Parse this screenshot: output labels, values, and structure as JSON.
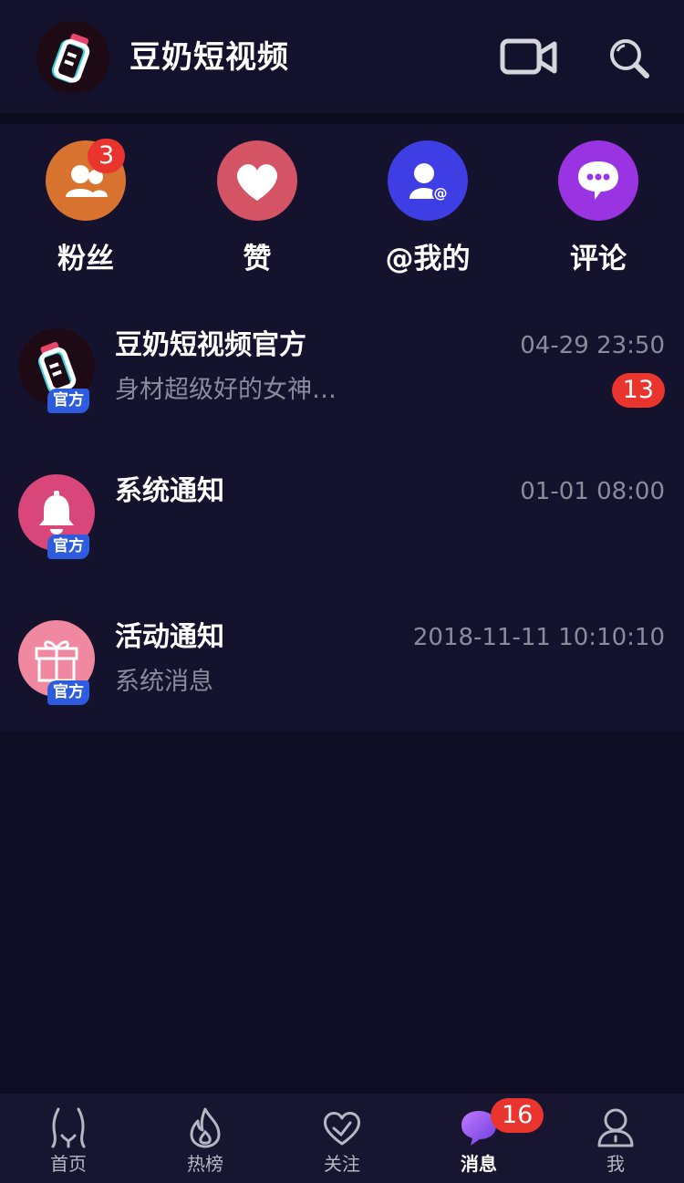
{
  "header": {
    "app_name": "豆奶短视频",
    "logo_icon": "milk-bottle-icon",
    "video_icon": "video-camera-icon",
    "search_icon": "search-icon"
  },
  "actions": [
    {
      "label": "粉丝",
      "icon": "fans-icon",
      "color": "#d8742f",
      "badge": "3"
    },
    {
      "label": "赞",
      "icon": "heart-icon",
      "color": "#d45466"
    },
    {
      "label": "@我的",
      "icon": "at-user-icon",
      "color": "#3f3ee4"
    },
    {
      "label": "评论",
      "icon": "comment-icon",
      "color": "#9a34e3"
    }
  ],
  "messages": [
    {
      "name": "豆奶短视频官方",
      "time": "04-29 23:50",
      "preview": "身材超级好的女神…",
      "unread": "13",
      "tag": "官方",
      "avatar_icon": "milk-bottle-icon"
    },
    {
      "name": "系统通知",
      "time": "01-01 08:00",
      "preview": "",
      "tag": "官方",
      "avatar_icon": "bell-icon",
      "color": "#d9467a"
    },
    {
      "name": "活动通知",
      "time": "2018-11-11 10:10:10",
      "preview": "系统消息",
      "tag": "官方",
      "avatar_icon": "gift-icon",
      "color": "#ef88a0"
    }
  ],
  "tabs": [
    {
      "label": "首页",
      "icon": "home-body-icon"
    },
    {
      "label": "热榜",
      "icon": "flame-icon"
    },
    {
      "label": "关注",
      "icon": "heart-outline-icon"
    },
    {
      "label": "消息",
      "icon": "chat-bubble-icon",
      "badge": "16",
      "active": true
    },
    {
      "label": "我",
      "icon": "person-icon"
    }
  ],
  "colors": {
    "background": "#100e25",
    "panel": "#14122d",
    "badge": "#e9352e",
    "official_tag": "#2f5bdf",
    "muted_text": "#8c8a9b"
  }
}
